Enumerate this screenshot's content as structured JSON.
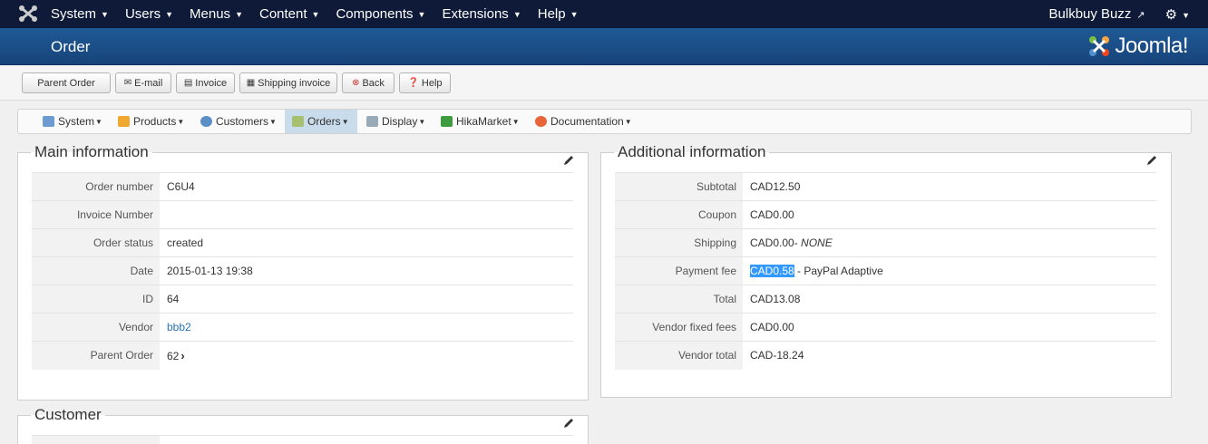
{
  "topbar": {
    "menus": [
      "System",
      "Users",
      "Menus",
      "Content",
      "Components",
      "Extensions",
      "Help"
    ],
    "site_name": "Bulkbuy Buzz"
  },
  "header": {
    "title": "Order",
    "brand": "Joomla!"
  },
  "toolbar": {
    "parent_order": "Parent Order",
    "email": "E-mail",
    "invoice": "Invoice",
    "shipping_invoice": "Shipping invoice",
    "back": "Back",
    "help": "Help"
  },
  "submenu": {
    "system": "System",
    "products": "Products",
    "customers": "Customers",
    "orders": "Orders",
    "display": "Display",
    "hikamarket": "HikaMarket",
    "documentation": "Documentation"
  },
  "main_info": {
    "legend": "Main information",
    "rows": [
      {
        "label": "Order number",
        "value": "C6U4"
      },
      {
        "label": "Invoice Number",
        "value": ""
      },
      {
        "label": "Order status",
        "value": "created"
      },
      {
        "label": "Date",
        "value": "2015-01-13 19:38"
      },
      {
        "label": "ID",
        "value": "64"
      },
      {
        "label": "Vendor",
        "value": "bbb2"
      },
      {
        "label": "Parent Order",
        "value": "62"
      }
    ]
  },
  "additional_info": {
    "legend": "Additional information",
    "rows": [
      {
        "label": "Subtotal",
        "value": "CAD12.50"
      },
      {
        "label": "Coupon",
        "value": "CAD0.00"
      },
      {
        "label": "Shipping",
        "value": "CAD0.00",
        "suffix": "- ",
        "suffix_em": "NONE"
      },
      {
        "label": "Payment fee",
        "value": "CAD0.58",
        "suffix": " - PayPal Adaptive"
      },
      {
        "label": "Total",
        "value": "CAD13.08"
      },
      {
        "label": "Vendor fixed fees",
        "value": "CAD0.00"
      },
      {
        "label": "Vendor total",
        "value": "CAD-18.24"
      }
    ]
  },
  "customer": {
    "legend": "Customer"
  },
  "colors": {
    "topbar": "#0e1a38",
    "header": "#1c4f8a",
    "link": "#2a72b5",
    "selection": "#3399ff"
  }
}
